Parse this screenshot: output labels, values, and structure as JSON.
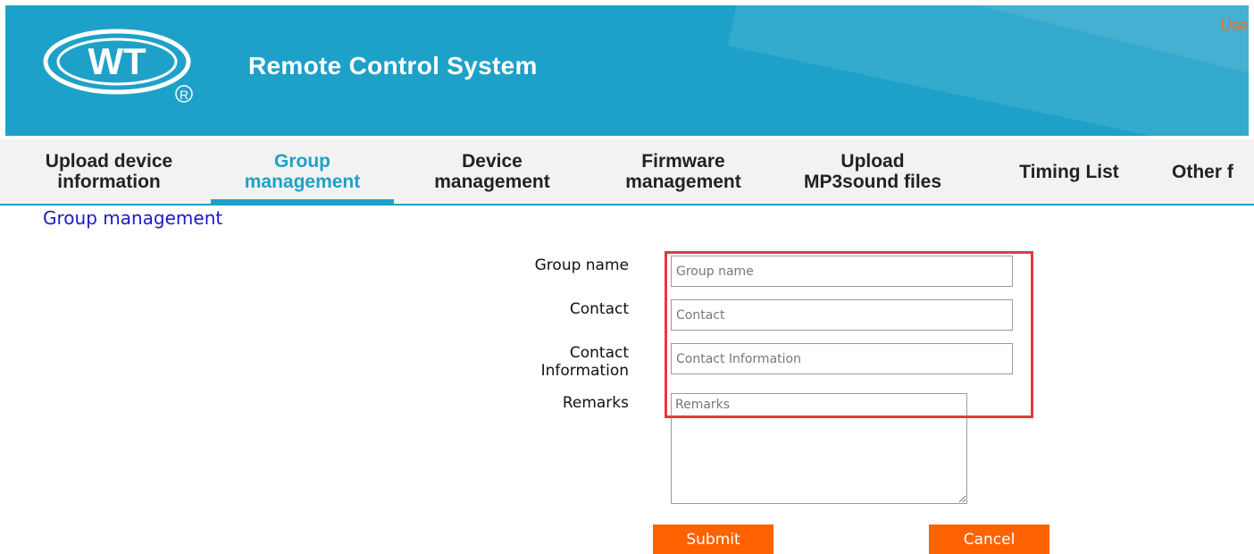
{
  "header": {
    "logo_text": "WT",
    "logo_mark": "®",
    "title": "Remote Control System",
    "user_link": "Use"
  },
  "nav": {
    "items": [
      {
        "label": "Upload device\ninformation",
        "active": false
      },
      {
        "label": "Group\nmanagement",
        "active": true
      },
      {
        "label": "Device\nmanagement",
        "active": false
      },
      {
        "label": "Firmware\nmanagement",
        "active": false
      },
      {
        "label": "Upload\nMP3sound files",
        "active": false
      },
      {
        "label": "Timing List",
        "active": false
      },
      {
        "label": "Other f",
        "active": false
      }
    ]
  },
  "page": {
    "section_title": "Group management"
  },
  "form": {
    "group_name": {
      "label": "Group name",
      "placeholder": "Group name",
      "value": ""
    },
    "contact": {
      "label": "Contact",
      "placeholder": "Contact",
      "value": ""
    },
    "contact_info": {
      "label": "Contact\nInformation",
      "placeholder": "Contact Information",
      "value": ""
    },
    "remarks": {
      "label": "Remarks",
      "placeholder": "Remarks",
      "value": ""
    },
    "submit_label": "Submit",
    "cancel_label": "Cancel"
  },
  "colors": {
    "header_bg": "#1ea1c9",
    "accent": "#1ea1c9",
    "button": "#ff6200",
    "highlight": "#e23b3b",
    "section_title": "#1a1acc"
  },
  "icons": {
    "logo": "wt-logo-icon",
    "resize": "resize-handle-icon"
  }
}
